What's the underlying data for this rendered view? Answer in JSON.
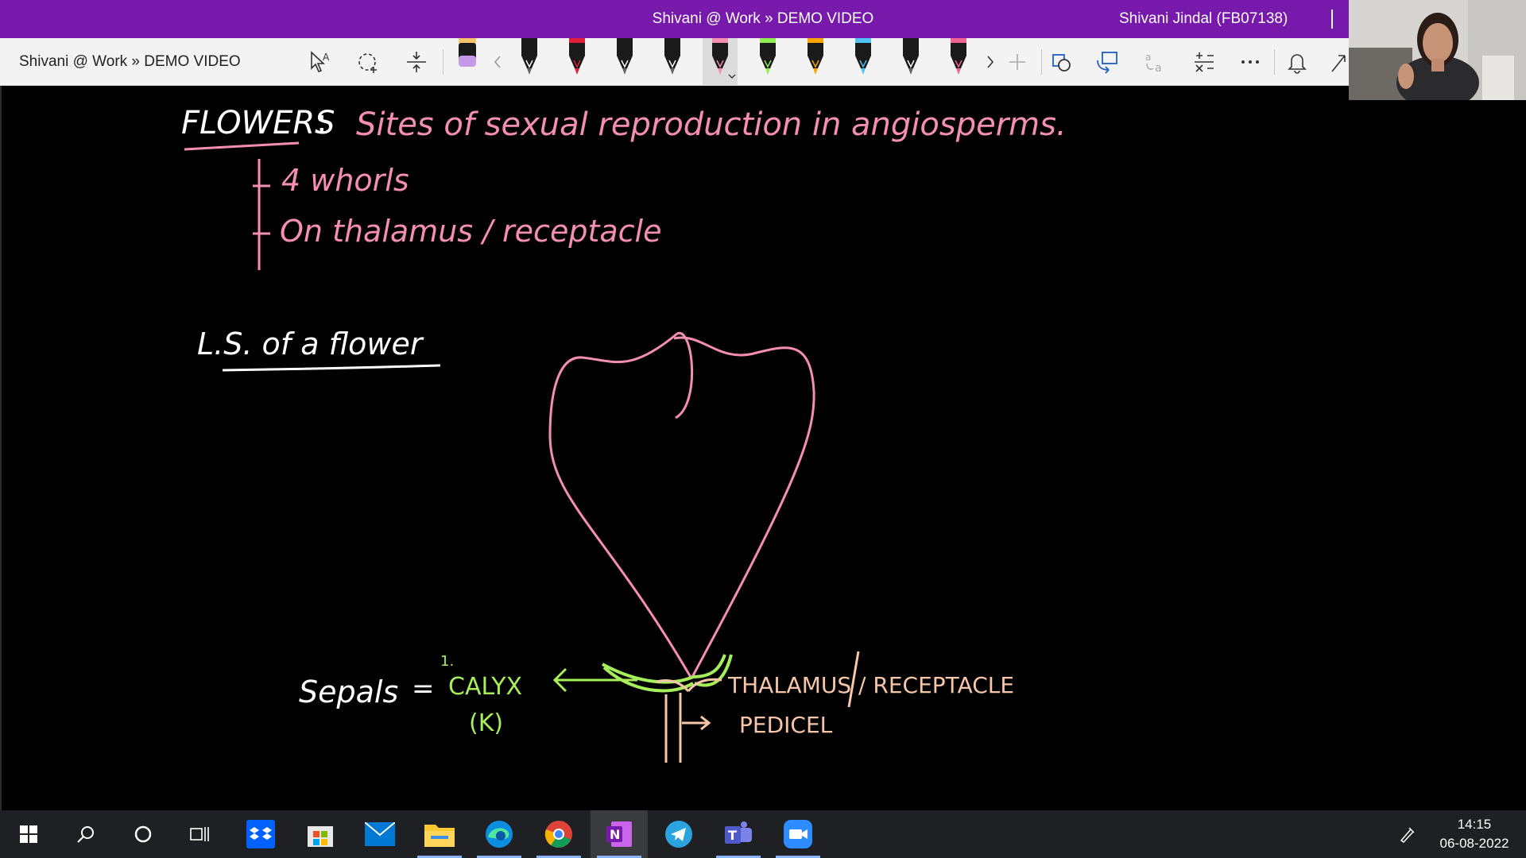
{
  "window": {
    "title": "Shivani @ Work » DEMO VIDEO",
    "user": "Shivani Jindal (FB07138)"
  },
  "toolbar": {
    "breadcrumb": "Shivani @ Work » DEMO VIDEO",
    "icons": [
      "lasso-select-icon",
      "add-space-icon",
      "highlighter-icon",
      "pen-icon",
      "shapes-icon",
      "ink-to-shape-icon",
      "ink-to-text-icon",
      "math-icon",
      "more-icon",
      "bell-icon"
    ],
    "pen_colors": [
      "#1a1a1a",
      "#e0203a",
      "#1a1a1a",
      "#1a1a1a",
      "#f48fb1",
      "#90ee50",
      "#ffa500",
      "#4fc3f7",
      "#1a1a1a",
      "#f06292"
    ],
    "active_pen_color": "#f48fb1"
  },
  "notes": {
    "line1_word": "FLOWERS",
    "line1_colon": ":",
    "line1_def": "Sites of sexual reproduction in angiosperms.",
    "bullet1": "4 whorls",
    "bullet2": "On thalamus / receptacle",
    "heading": "L.S. of a flower"
  },
  "diagram": {
    "label_number": "1.",
    "sepals": "Sepals",
    "equals": "=",
    "calyx": "CALYX",
    "calyx_symbol": "(K)",
    "thalamus": "THALAMUS / RECEPTACLE",
    "pedicel": "PEDICEL"
  },
  "ink_colors": {
    "pink": "#f58fb1",
    "white": "#ffffff",
    "green": "#a6ee5a",
    "peach": "#f8c6a8"
  },
  "taskbar": {
    "apps": [
      "start-icon",
      "search-icon",
      "cortana-icon",
      "task-view-icon",
      "dropbox-icon",
      "microsoft-store-icon",
      "mail-icon",
      "file-explorer-icon",
      "edge-icon",
      "chrome-icon",
      "onenote-icon",
      "telegram-icon",
      "teams-icon",
      "zoom-icon"
    ],
    "time": "14:15",
    "date": "06-08-2022"
  }
}
